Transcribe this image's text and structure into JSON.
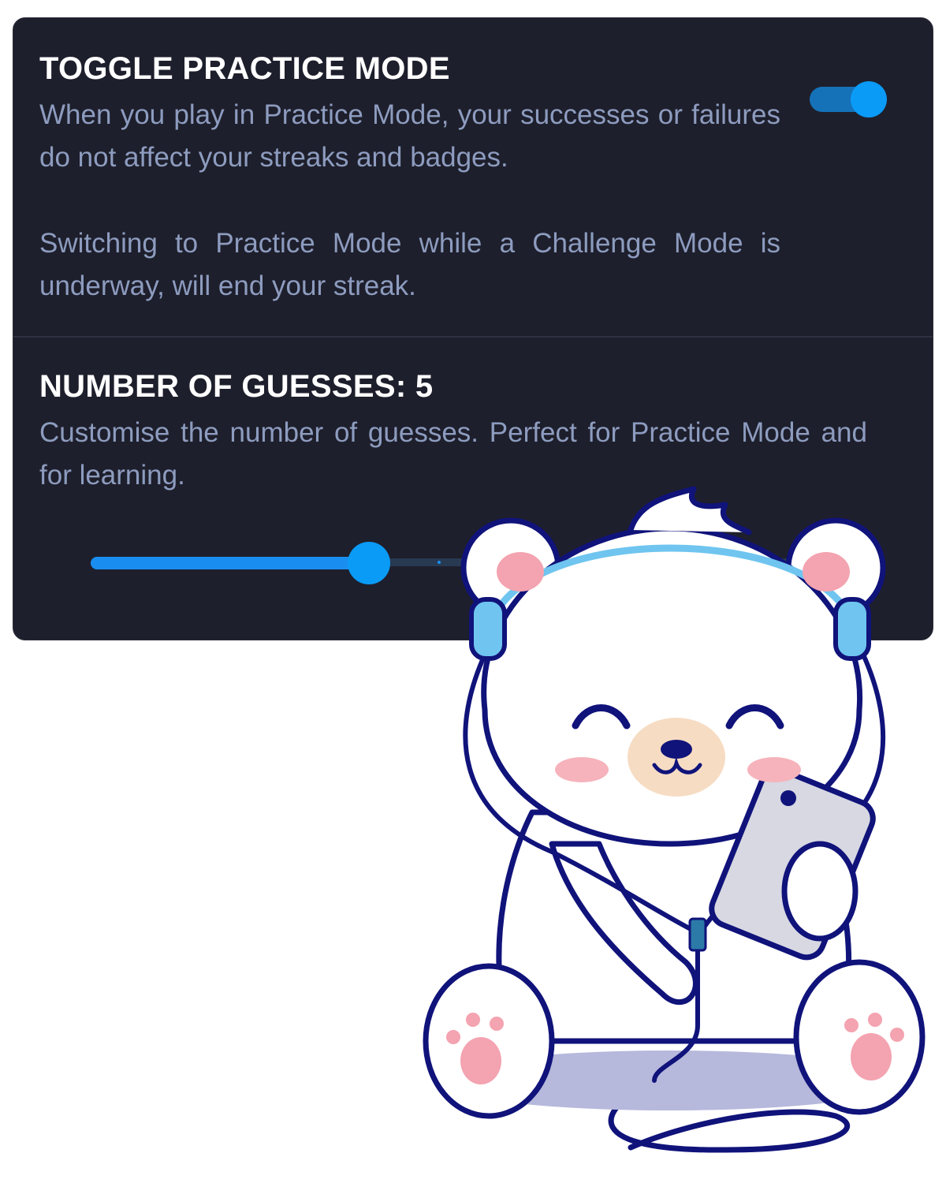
{
  "settings": {
    "practice_mode": {
      "title": "TOGGLE PRACTICE MODE",
      "description_1": "When you play in Practice Mode, your successes or failures do not affect your streaks and badges.",
      "description_2": "Switching to Practice Mode while a Challenge Mode is underway, will end your streak.",
      "enabled": true
    },
    "guesses": {
      "title": "NUMBER OF GUESSES: 5",
      "description": "Customise the number of guesses. Perfect for Practice Mode and for learning.",
      "value": 5,
      "slider_fraction": 0.353
    }
  },
  "colors": {
    "panel_bg": "#1e1f2c",
    "accent": "#0a9bf7",
    "text_primary": "#ffffff",
    "text_secondary": "#8d9cbf"
  },
  "illustration": {
    "icon": "polar-bear-with-headphones-and-phone-icon"
  }
}
